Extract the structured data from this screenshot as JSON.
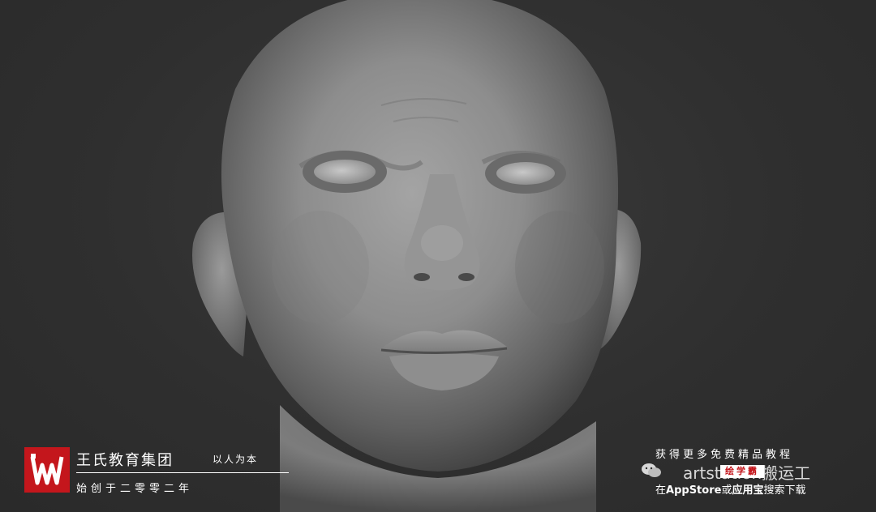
{
  "brand": {
    "name": "王氏教育集团",
    "motto": "以人为本",
    "founded": "始创于二零零二年",
    "logo_color": "#c4161c"
  },
  "promo": {
    "line1": "获得更多免费精品教程",
    "badge": "绘学霸",
    "watermark": "artstation搬运工",
    "line3_prefix": "在",
    "line3_store": "AppStore",
    "line3_middle": "或",
    "line3_app": "应用宝",
    "line3_suffix": "搜索下载"
  },
  "scene": {
    "subject": "bald-head-sculpt",
    "background_color": "#2e2e2e",
    "sculpt_color": "#8f8f8f"
  }
}
